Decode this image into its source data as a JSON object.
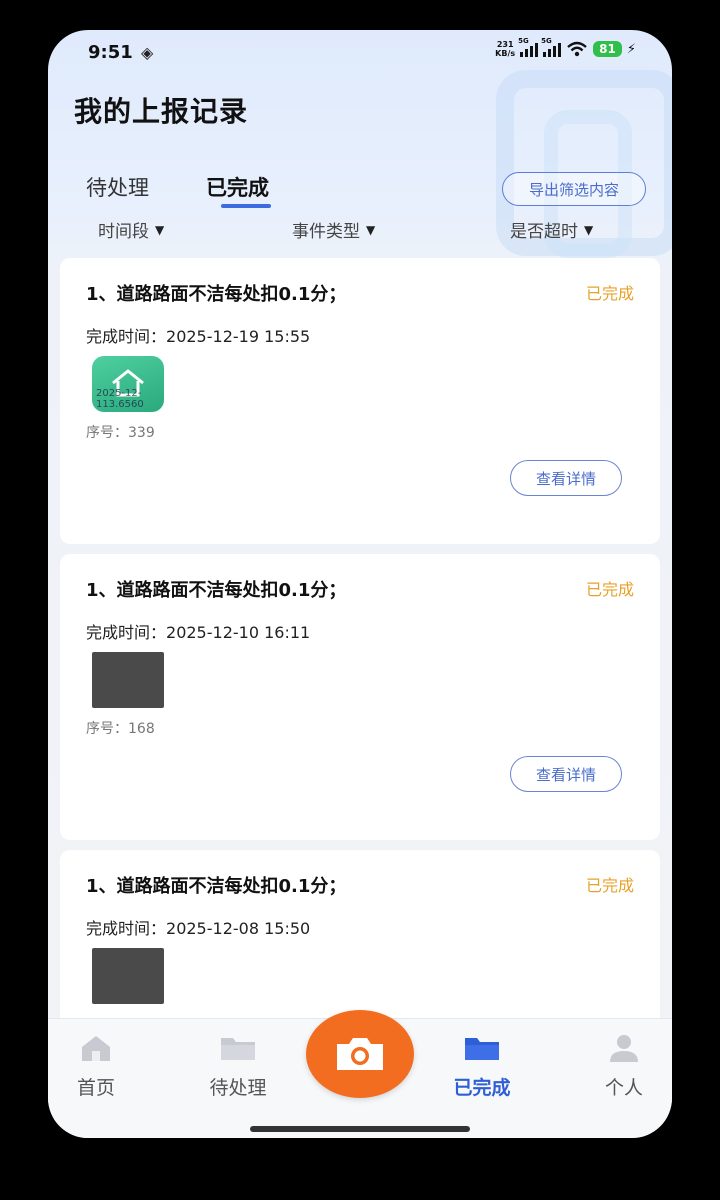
{
  "status_bar": {
    "time": "9:51",
    "net_speed_top": "231",
    "net_speed_bottom": "KB/s",
    "signal1_tag": "5G",
    "signal2_tag": "5G",
    "battery": "81",
    "icons": [
      "nfc-icon",
      "signal-icon",
      "wifi-icon",
      "battery-icon",
      "charging-icon"
    ]
  },
  "header": {
    "title": "我的上报记录"
  },
  "tabs": [
    {
      "label": "待处理",
      "active": false
    },
    {
      "label": "已完成",
      "active": true
    }
  ],
  "export_button": "导出筛选内容",
  "filters": [
    {
      "label": "时间段"
    },
    {
      "label": "事件类型"
    },
    {
      "label": "是否超时"
    }
  ],
  "records": [
    {
      "title": "1、道路路面不洁每处扣0.1分；",
      "status": "已完成",
      "time_label": "完成时间：",
      "time": "2025-12-19 15:55",
      "thumb_watermark": "2025-12-\n113.6560",
      "serial_label": "序号：",
      "serial": "339",
      "detail_button": "查看详情"
    },
    {
      "title": "1、道路路面不洁每处扣0.1分；",
      "status": "已完成",
      "time_label": "完成时间：",
      "time": "2025-12-10 16:11",
      "serial_label": "序号：",
      "serial": "168",
      "detail_button": "查看详情"
    },
    {
      "title": "1、道路路面不洁每处扣0.1分；",
      "status": "已完成",
      "time_label": "完成时间：",
      "time": "2025-12-08 15:50"
    }
  ],
  "bottom_nav": [
    {
      "label": "首页",
      "icon": "home-icon",
      "active": false
    },
    {
      "label": "待处理",
      "icon": "folder-icon",
      "active": false
    },
    {
      "label": "",
      "icon": "camera-icon",
      "active": false
    },
    {
      "label": "已完成",
      "icon": "folder-icon",
      "active": true
    },
    {
      "label": "个人",
      "icon": "user-icon",
      "active": false
    }
  ],
  "colors": {
    "accent": "#2f5fd6",
    "status_done": "#e8a12c",
    "camera": "#f26d1f"
  }
}
